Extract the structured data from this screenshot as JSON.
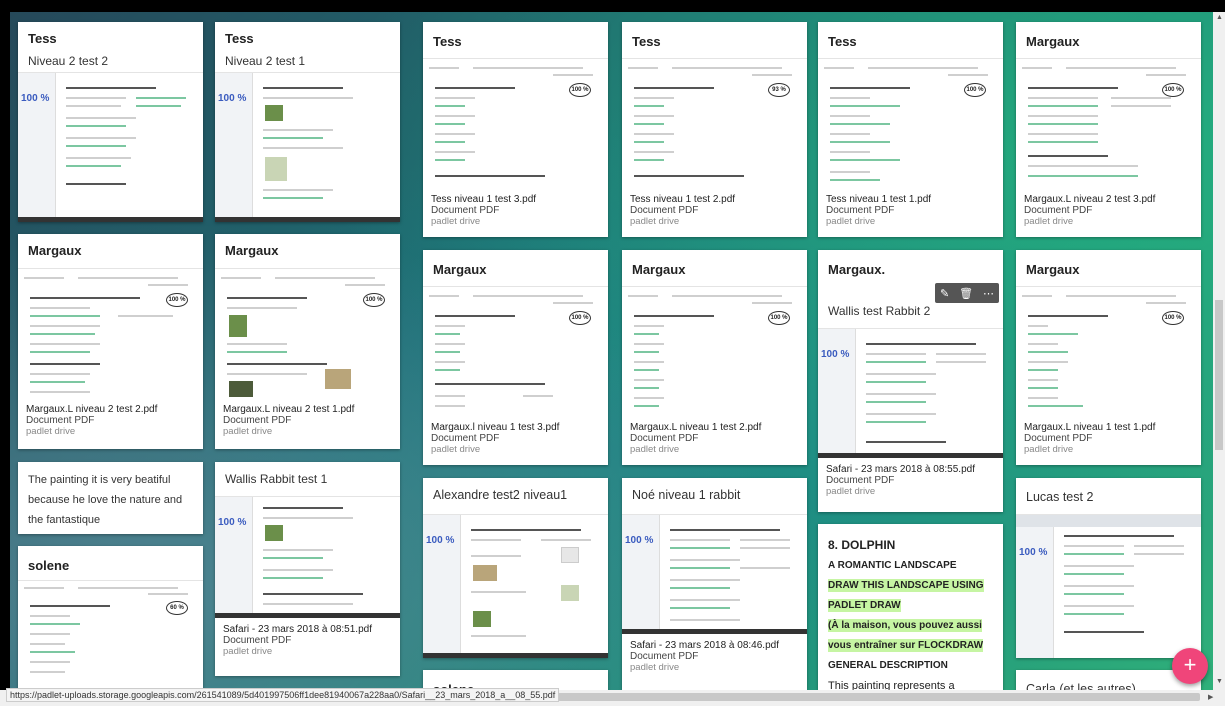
{
  "colors": {
    "fab": "#f0457a",
    "score_blue": "#3a5bbf",
    "highlight": "#c6f5a3"
  },
  "cards": {
    "c1": {
      "author": "Tess",
      "title": "Niveau 2 test 2",
      "score": "100 %"
    },
    "c2": {
      "author": "Tess",
      "title": "Niveau 2 test 1",
      "score": "100 %"
    },
    "c3": {
      "author": "Tess",
      "score": "100 %",
      "file": "Tess niveau 1 test 3.pdf",
      "type": "Document PDF",
      "source": "padlet drive"
    },
    "c4": {
      "author": "Tess",
      "score": "93 %",
      "file": "Tess niveau 1 test 2.pdf",
      "type": "Document PDF",
      "source": "padlet drive"
    },
    "c5": {
      "author": "Tess",
      "score": "100 %",
      "file": "Tess niveau 1 test 1.pdf",
      "type": "Document PDF",
      "source": "padlet drive"
    },
    "c6": {
      "author": "Margaux",
      "score": "100 %",
      "file": "Margaux.L niveau 2 test 3.pdf",
      "type": "Document PDF",
      "source": "padlet drive"
    },
    "c7": {
      "author": "Margaux",
      "score": "100 %",
      "file": "Margaux.L niveau 2 test 2.pdf",
      "type": "Document PDF",
      "source": "padlet drive"
    },
    "c8": {
      "author": "Margaux",
      "score": "100 %",
      "file": "Margaux.L niveau 2 test 1.pdf",
      "type": "Document PDF",
      "source": "padlet drive"
    },
    "c9": {
      "author": "Margaux",
      "score": "100 %",
      "file": "Margaux.l niveau 1 test 3.pdf",
      "type": "Document PDF",
      "source": "padlet drive"
    },
    "c10": {
      "author": "Margaux",
      "score": "100 %",
      "file": "Margaux.L niveau 1 test 2.pdf",
      "type": "Document PDF",
      "source": "padlet drive"
    },
    "c11": {
      "author": "Margaux.",
      "title": "Wallis test Rabbit 2",
      "score": "100 %",
      "file": "Safari - 23 mars 2018 à 08:55.pdf",
      "type": "Document PDF",
      "source": "padlet drive"
    },
    "c12": {
      "author": "Margaux",
      "score": "100 %",
      "file": "Margaux.L niveau 1 test 1.pdf",
      "type": "Document PDF",
      "source": "padlet drive"
    },
    "c13": {
      "text": "The painting it is very beatiful because he love the nature and the fantastique"
    },
    "c14": {
      "title": "Wallis Rabbit test 1",
      "score": "100 %",
      "file": "Safari - 23 mars 2018 à 08:51.pdf",
      "type": "Document PDF",
      "source": "padlet drive"
    },
    "c15": {
      "author": "solene",
      "score": "60 %"
    },
    "c16": {
      "title": "Alexandre test2 niveau1",
      "score": "100 %"
    },
    "c17": {
      "title": "Noé niveau 1 rabbit",
      "score": "100 %",
      "file": "Safari - 23 mars 2018 à 08:46.pdf",
      "type": "Document PDF",
      "source": "padlet drive"
    },
    "c18": {
      "heading": "8. DOLPHIN",
      "line1": "A ROMANTIC LANDSCAPE",
      "line2": "DRAW THIS LANDSCAPE USING",
      "line3": "PADLET DRAW",
      "line4": "(À la maison, vous pouvez aussi",
      "line5": "vous entraîner sur  FLOCKDRAW",
      "line6": "GENERAL DESCRIPTION",
      "line7": "This painting represents a"
    },
    "c19": {
      "title": "Lucas test 2",
      "score": "100 %"
    },
    "c20": {
      "author": "solene"
    },
    "c21": {
      "title": "Carla (et les autres)"
    }
  },
  "toolbar": {
    "edit_icon": "pencil-icon",
    "delete_icon": "trash-icon",
    "more_icon": "more-icon"
  },
  "fab_label": "+",
  "status_url": "https://padlet-uploads.storage.googleapis.com/261541089/5d401997506ff1dee81940067a228aa0/Safari__23_mars_2018_a__08_55.pdf"
}
